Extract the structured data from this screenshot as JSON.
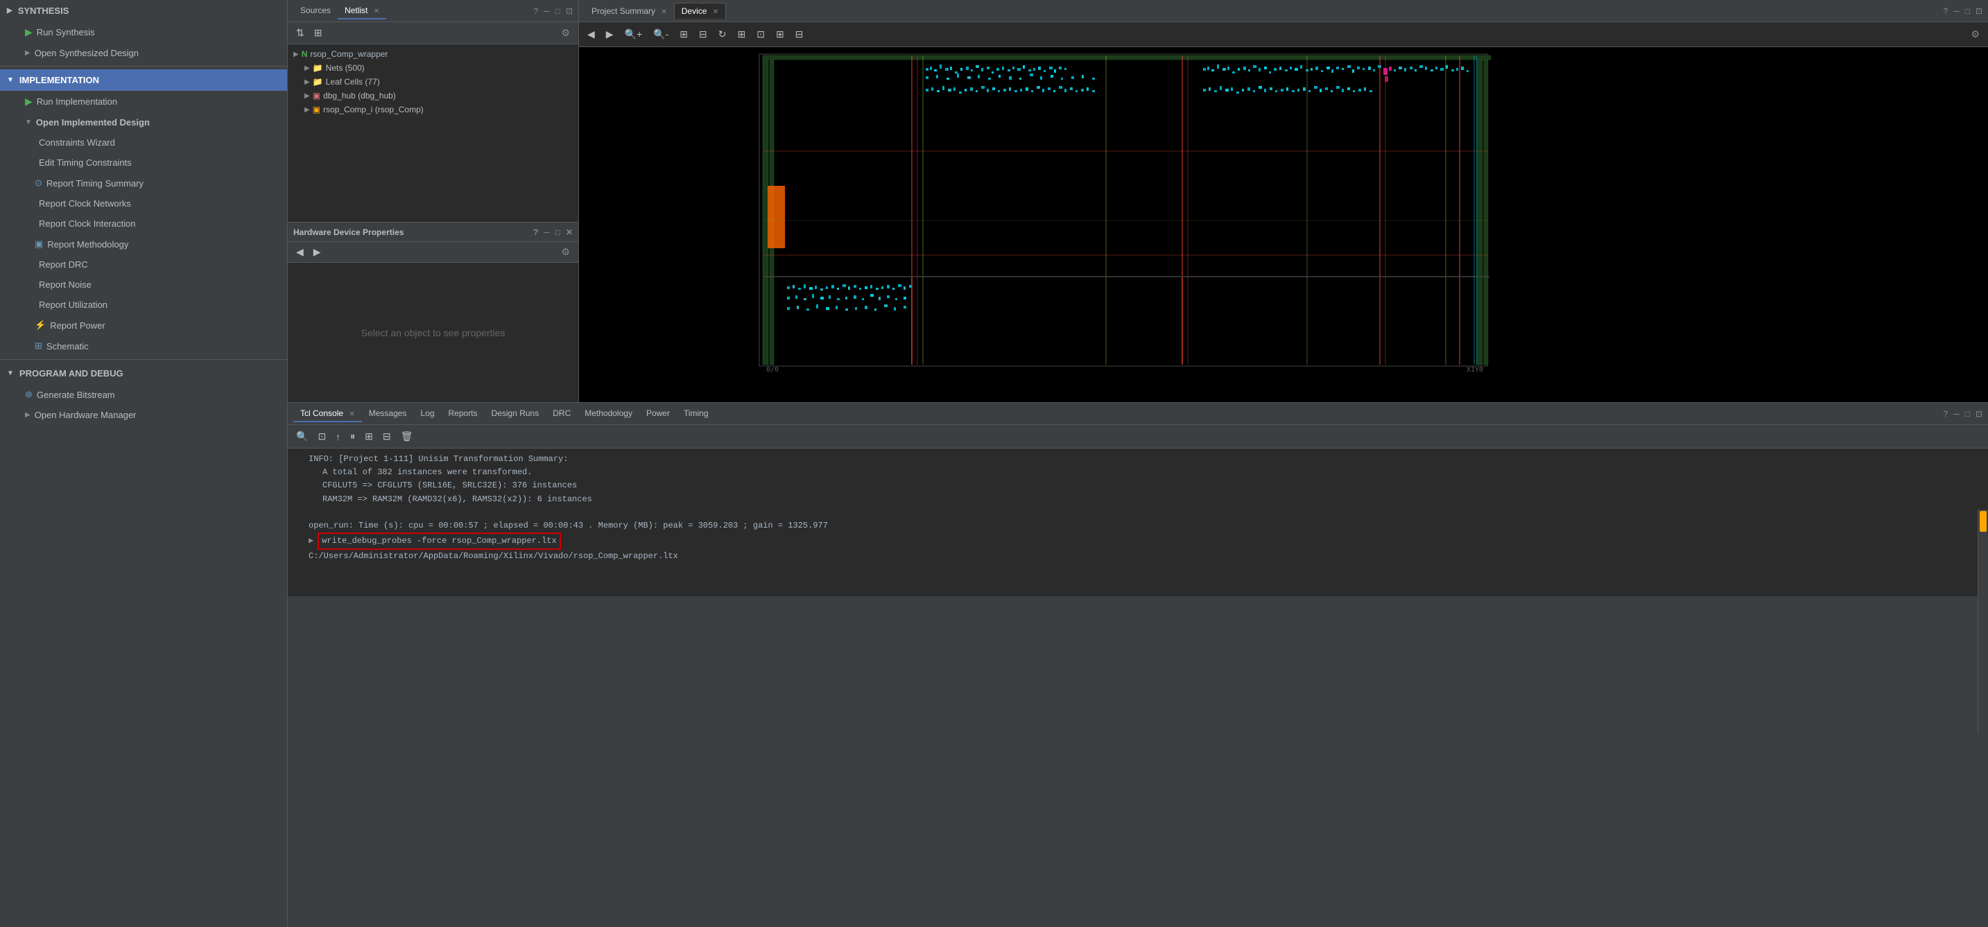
{
  "sidebar": {
    "sections": [
      {
        "id": "synthesis",
        "label": "SYNTHESIS",
        "expanded": false,
        "items": [
          {
            "id": "run-synthesis",
            "label": "Run Synthesis",
            "icon": "run",
            "indent": 1
          },
          {
            "id": "open-synthesized-design",
            "label": "Open Synthesized Design",
            "icon": "expand",
            "indent": 1
          }
        ]
      },
      {
        "id": "implementation",
        "label": "IMPLEMENTATION",
        "expanded": true,
        "items": [
          {
            "id": "run-implementation",
            "label": "Run Implementation",
            "icon": "run",
            "indent": 1
          },
          {
            "id": "open-implemented-design",
            "label": "Open Implemented Design",
            "icon": "collapse",
            "indent": 1
          },
          {
            "id": "constraints-wizard",
            "label": "Constraints Wizard",
            "icon": "",
            "indent": 2
          },
          {
            "id": "edit-timing-constraints",
            "label": "Edit Timing Constraints",
            "icon": "",
            "indent": 2
          },
          {
            "id": "report-timing-summary",
            "label": "Report Timing Summary",
            "icon": "clock",
            "indent": 2
          },
          {
            "id": "report-clock-networks",
            "label": "Report Clock Networks",
            "icon": "",
            "indent": 2
          },
          {
            "id": "report-clock-interaction",
            "label": "Report Clock Interaction",
            "icon": "",
            "indent": 2
          },
          {
            "id": "report-methodology",
            "label": "Report Methodology",
            "icon": "doc",
            "indent": 2
          },
          {
            "id": "report-drc",
            "label": "Report DRC",
            "icon": "",
            "indent": 2
          },
          {
            "id": "report-noise",
            "label": "Report Noise",
            "icon": "",
            "indent": 2
          },
          {
            "id": "report-utilization",
            "label": "Report Utilization",
            "icon": "",
            "indent": 2
          },
          {
            "id": "report-power",
            "label": "Report Power",
            "icon": "power",
            "indent": 2
          },
          {
            "id": "schematic",
            "label": "Schematic",
            "icon": "schematic",
            "indent": 2
          }
        ]
      },
      {
        "id": "program-debug",
        "label": "PROGRAM AND DEBUG",
        "expanded": true,
        "items": [
          {
            "id": "generate-bitstream",
            "label": "Generate Bitstream",
            "icon": "bitstream",
            "indent": 1
          },
          {
            "id": "open-hardware-manager",
            "label": "Open Hardware Manager",
            "icon": "expand",
            "indent": 1
          }
        ]
      }
    ]
  },
  "sources_panel": {
    "tabs": [
      {
        "id": "sources",
        "label": "Sources",
        "active": false
      },
      {
        "id": "netlist",
        "label": "Netlist",
        "active": true
      }
    ],
    "tree": [
      {
        "id": "rsop-comp-wrapper",
        "label": "rsop_Comp_wrapper",
        "icon": "N",
        "level": 0,
        "expanded": true
      },
      {
        "id": "nets",
        "label": "Nets (500)",
        "icon": "folder",
        "level": 1,
        "expanded": false
      },
      {
        "id": "leaf-cells",
        "label": "Leaf Cells (77)",
        "icon": "folder",
        "level": 1,
        "expanded": false
      },
      {
        "id": "dbg-hub",
        "label": "dbg_hub (dbg_hub)",
        "icon": "cell-orange",
        "level": 1,
        "expanded": false
      },
      {
        "id": "rsop-comp-i",
        "label": "rsop_Comp_i (rsop_Comp)",
        "icon": "cell-red",
        "level": 1,
        "expanded": false
      }
    ]
  },
  "device_panel": {
    "tabs": [
      {
        "id": "project-summary",
        "label": "Project Summary",
        "active": false
      },
      {
        "id": "device",
        "label": "Device",
        "active": true
      }
    ]
  },
  "hdp_panel": {
    "title": "Hardware Device Properties",
    "empty_message": "Select an object to see properties"
  },
  "console_panel": {
    "tabs": [
      {
        "id": "tcl-console",
        "label": "Tcl Console",
        "active": true
      },
      {
        "id": "messages",
        "label": "Messages",
        "active": false
      },
      {
        "id": "log",
        "label": "Log",
        "active": false
      },
      {
        "id": "reports",
        "label": "Reports",
        "active": false
      },
      {
        "id": "design-runs",
        "label": "Design Runs",
        "active": false
      },
      {
        "id": "drc",
        "label": "DRC",
        "active": false
      },
      {
        "id": "methodology",
        "label": "Methodology",
        "active": false
      },
      {
        "id": "power",
        "label": "Power",
        "active": false
      },
      {
        "id": "timing",
        "label": "Timing",
        "active": false
      }
    ],
    "lines": [
      {
        "id": "info-line",
        "text": "INFO: [Project 1-111] Unisim Transformation Summary:",
        "indent": 0
      },
      {
        "id": "total-instances",
        "text": "A total of 382 instances were transformed.",
        "indent": 1
      },
      {
        "id": "cfglut5",
        "text": "CFGLUT5 => CFGLUT5 (SRL16E, SRLC32E): 376 instances",
        "indent": 1
      },
      {
        "id": "ram32m",
        "text": "RAM32M => RAM32M (RAMD32(x6), RAMS32(x2)): 6 instances",
        "indent": 1
      },
      {
        "id": "blank1",
        "text": "",
        "indent": 0
      },
      {
        "id": "open-run",
        "text": "open_run: Time (s): cpu = 00:00:57 ; elapsed = 00:00:43 . Memory (MB): peak = 3059.203 ; gain = 1325.977",
        "indent": 0
      },
      {
        "id": "write-debug",
        "text": "write_debug_probes -force rsop_Comp_wrapper.ltx",
        "indent": 0,
        "highlighted": true
      },
      {
        "id": "path-line",
        "text": "C:/Users/Administrator/AppData/Roaming/Xilinx/Vivado/rsop_Comp_wrapper.ltx",
        "indent": 0
      }
    ]
  },
  "colors": {
    "accent": "#4b6eaf",
    "run_green": "#4CAF50",
    "warning_orange": "#FFA500",
    "highlight_red": "#cc0000",
    "text_primary": "#bbbbbb",
    "bg_dark": "#2b2b2b",
    "bg_medium": "#3c3f41"
  }
}
